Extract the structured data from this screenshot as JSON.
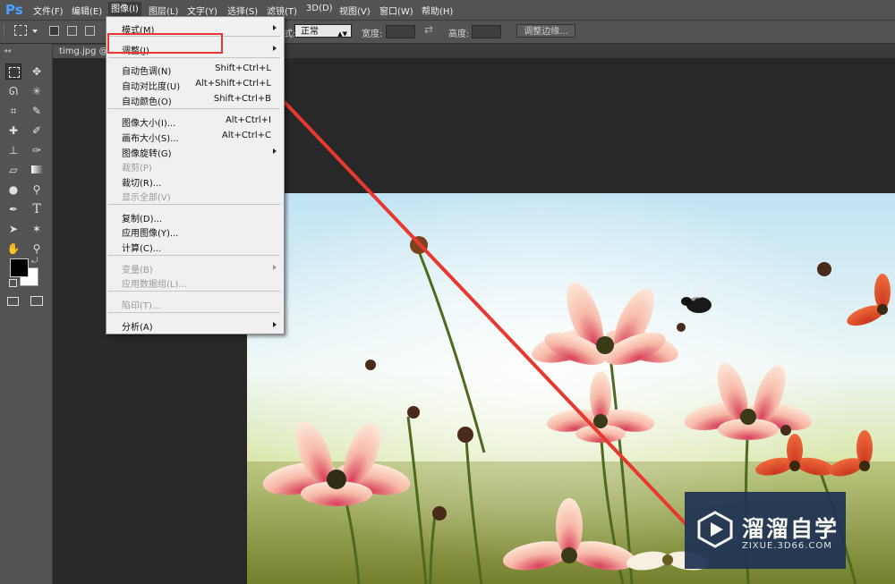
{
  "app": {
    "logo": "Ps"
  },
  "menubar": {
    "items": [
      "文件(F)",
      "编辑(E)",
      "图像(I)",
      "图层(L)",
      "文字(Y)",
      "选择(S)",
      "滤镜(T)",
      "3D(D)",
      "视图(V)",
      "窗口(W)",
      "帮助(H)"
    ],
    "active": "图像(I)"
  },
  "options_bar": {
    "style_label": "式:",
    "style_value": "正常",
    "width_label": "宽度:",
    "height_label": "高度:",
    "refine_button": "调整边缘..."
  },
  "document": {
    "tab_title": "timg.jpg @"
  },
  "image_menu": {
    "items": [
      {
        "label": "模式(M)",
        "submenu": true
      },
      {
        "label": "调整(J)",
        "submenu": true,
        "highlighted": true
      },
      {
        "label": "自动色调(N)",
        "shortcut": "Shift+Ctrl+L"
      },
      {
        "label": "自动对比度(U)",
        "shortcut": "Alt+Shift+Ctrl+L"
      },
      {
        "label": "自动颜色(O)",
        "shortcut": "Shift+Ctrl+B"
      },
      {
        "label": "图像大小(I)...",
        "shortcut": "Alt+Ctrl+I"
      },
      {
        "label": "画布大小(S)...",
        "shortcut": "Alt+Ctrl+C"
      },
      {
        "label": "图像旋转(G)",
        "submenu": true
      },
      {
        "label": "裁剪(P)",
        "disabled": true
      },
      {
        "label": "裁切(R)..."
      },
      {
        "label": "显示全部(V)",
        "disabled": true
      },
      {
        "label": "复制(D)..."
      },
      {
        "label": "应用图像(Y)..."
      },
      {
        "label": "计算(C)..."
      },
      {
        "label": "变量(B)",
        "submenu": true,
        "disabled": true
      },
      {
        "label": "应用数据组(L)...",
        "disabled": true
      },
      {
        "label": "陷印(T)...",
        "disabled": true
      },
      {
        "label": "分析(A)",
        "submenu": true
      }
    ]
  },
  "watermark": {
    "brand": "溜溜自学",
    "url": "ZIXUE.3D66.COM"
  },
  "colors": {
    "highlight_box": "#e8382f",
    "menubar": "#535353",
    "watermark_bg": "#1f3354"
  }
}
